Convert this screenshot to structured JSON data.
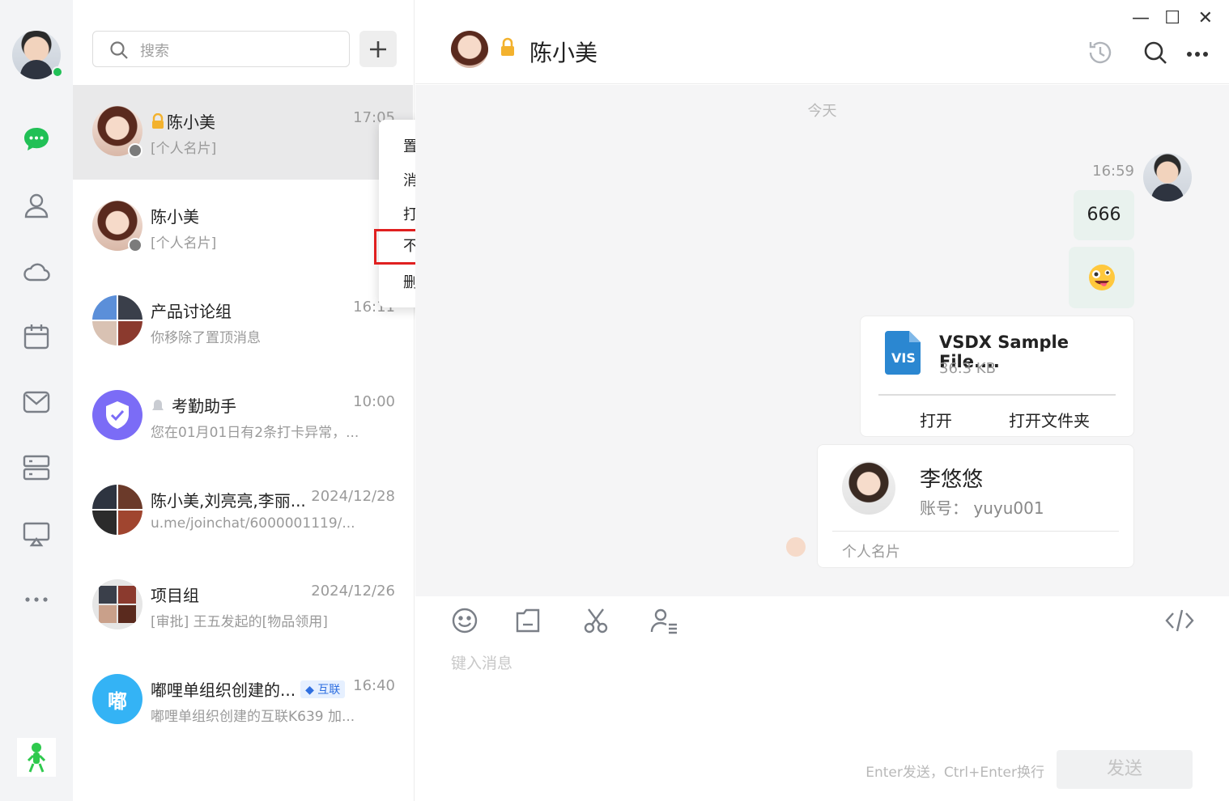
{
  "search": {
    "placeholder": "搜索"
  },
  "chat_list": [
    {
      "name": "陈小美",
      "time": "17:05",
      "preview": "[个人名片]",
      "locked": true
    },
    {
      "name": "陈小美",
      "time": "",
      "preview": "[个人名片]"
    },
    {
      "name": "产品讨论组",
      "time": "16:11",
      "preview": "你移除了置顶消息"
    },
    {
      "name": "考勤助手",
      "time": "10:00",
      "preview": "您在01月01日有2条打卡异常，..."
    },
    {
      "name": "陈小美,刘亮亮,李丽...",
      "time": "2024/12/28",
      "preview": "u.me/joinchat/6000001119/..."
    },
    {
      "name": "项目组",
      "time": "2024/12/26",
      "preview": "[审批] 王五发起的[物品领用]"
    },
    {
      "name": "嘟哩单组织创建的...",
      "tag": "互联",
      "time": "16:40",
      "preview": "嘟哩单组织创建的互联K639 加...",
      "avatar_text": "嘟"
    }
  ],
  "context_menu": {
    "items": [
      "置顶消息",
      "消息免打扰",
      "打开独立窗口",
      "不显示聊天",
      "删除聊天"
    ]
  },
  "conversation": {
    "title": "陈小美",
    "date_divider": "今天",
    "message_time": "16:59",
    "text_message": "666",
    "emoji_message": "😜",
    "file": {
      "name": "VSDX Sample File....",
      "size": "36.3 KB",
      "icon_label": "VIS",
      "open": "打开",
      "open_folder": "打开文件夹"
    },
    "contact_card": {
      "name": "李悠悠",
      "account_label": "账号：",
      "account": "yuyu001",
      "card_label": "个人名片"
    },
    "compose_placeholder": "键入消息",
    "hint": "Enter发送，Ctrl+Enter换行",
    "send": "发送"
  },
  "window_controls": {
    "minimize": "—",
    "maximize": "☐",
    "close": "✕"
  },
  "colors": {
    "online": "#21c056",
    "accent_green": "#21c056",
    "highlight_border": "#e02020",
    "file_icon": "#2b87d1",
    "attendance_icon": "#7b6cf6",
    "dulidan_avatar": "#34b3f5"
  }
}
